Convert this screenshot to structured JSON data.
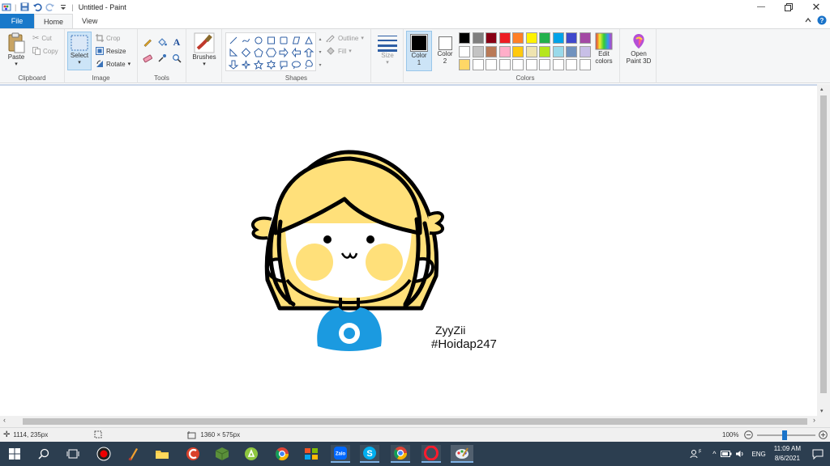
{
  "window": {
    "title": "Untitled - Paint"
  },
  "tabs": [
    {
      "label": "File"
    },
    {
      "label": "Home"
    },
    {
      "label": "View"
    }
  ],
  "ribbon": {
    "clipboard": {
      "paste": "Paste",
      "cut": "Cut",
      "copy": "Copy",
      "label": "Clipboard"
    },
    "image": {
      "select": "Select",
      "crop": "Crop",
      "resize": "Resize",
      "rotate": "Rotate",
      "label": "Image"
    },
    "tools": {
      "label": "Tools"
    },
    "brushes": {
      "label": "Brushes"
    },
    "shapes": {
      "label": "Shapes",
      "outline": "Outline",
      "fill": "Fill"
    },
    "size": {
      "label": "Size"
    },
    "color1": {
      "label": "Color",
      "index": "1"
    },
    "color2": {
      "label": "Color",
      "index": "2"
    },
    "colors": {
      "label": "Colors",
      "row1": [
        "#000000",
        "#7f7f7f",
        "#880015",
        "#ed1c24",
        "#ff7f27",
        "#fff200",
        "#22b14c",
        "#00a2e8",
        "#3f48cc",
        "#a349a4"
      ],
      "row2": [
        "#ffffff",
        "#c3c3c3",
        "#b97a57",
        "#ffaec9",
        "#ffc90e",
        "#efe4b0",
        "#b5e61d",
        "#99d9ea",
        "#7092be",
        "#c8bfe7"
      ],
      "row3": [
        "#ffd766",
        "#ffffff",
        "#ffffff",
        "#ffffff",
        "#ffffff",
        "#ffffff",
        "#ffffff",
        "#ffffff",
        "#ffffff",
        "#ffffff"
      ]
    },
    "edit_colors": {
      "line1": "Edit",
      "line2": "colors"
    },
    "paint3d": {
      "line1": "Open",
      "line2": "Paint 3D"
    }
  },
  "canvas": {
    "signature_name": "ZyyZii",
    "signature_tag": "#Hoidap247",
    "colors": {
      "hair": "#ffe07a",
      "shirt": "#1b9ae0",
      "blush": "#ffe07a"
    }
  },
  "status": {
    "cursor_pos": "1114, 235px",
    "canvas_size": "1360 × 575px",
    "zoom": "100%"
  },
  "taskbar": {
    "lang": "ENG",
    "time": "11:09 AM",
    "date": "8/6/2021",
    "zalo": "Zalo"
  }
}
